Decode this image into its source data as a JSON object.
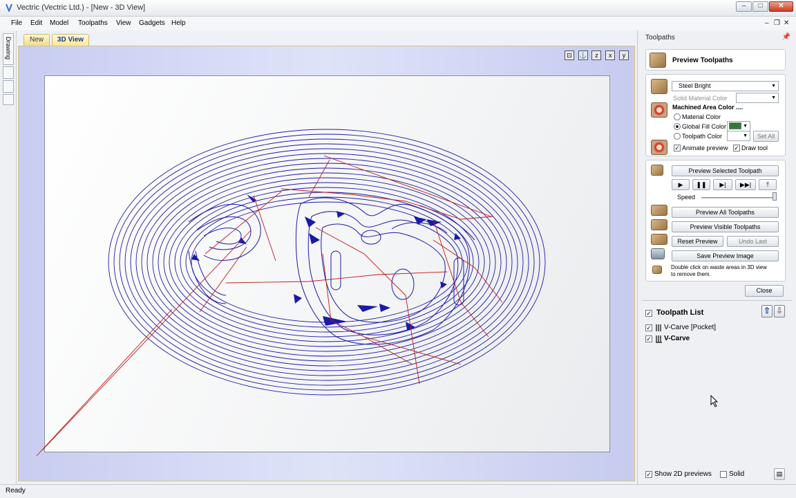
{
  "window": {
    "title": "Vectric (Vectric Ltd.) - [New - 3D View]",
    "controls": {
      "minimize": "–",
      "maximize": "□",
      "close": "✕"
    }
  },
  "menu": {
    "items": [
      "File",
      "Edit",
      "Model",
      "Toolpaths",
      "View",
      "Gadgets",
      "Help"
    ],
    "doc_controls": {
      "minimize": "–",
      "restore": "❐",
      "close": "✕"
    }
  },
  "left_strip": {
    "tab_label": "Drawing"
  },
  "tabs": [
    {
      "label": "New",
      "active": false
    },
    {
      "label": "3D View",
      "active": true
    }
  ],
  "view_toolbar": {
    "icons": [
      "zoom-extents-icon",
      "view-iso-icon",
      "view-z-icon",
      "view-x-icon",
      "view-y-icon"
    ],
    "labels": [
      "⊡",
      "⚓",
      "z",
      "x",
      "y"
    ]
  },
  "toolpaths_panel": {
    "title": "Toolpaths",
    "preview_header": "Preview Toolpaths",
    "material": {
      "selected": "Steel Bright",
      "solid_material_color_label": "Solid Material Color",
      "machined_area_color_label": "Machined Area Color ....",
      "options": [
        {
          "label": "Material Color",
          "selected": false
        },
        {
          "label": "Global Fill Color",
          "selected": true
        },
        {
          "label": "Toolpath Color",
          "selected": false
        }
      ],
      "global_fill_color": "#2e7d32",
      "set_all_label": "Set All",
      "animate_preview": {
        "label": "Animate preview",
        "checked": true
      },
      "draw_tool": {
        "label": "Draw tool",
        "checked": true
      }
    },
    "preview": {
      "preview_selected": "Preview Selected Toolpath",
      "playback": {
        "play": "▶",
        "pause": "❚❚",
        "step": "▶|",
        "fast_forward": "▶▶|",
        "to_top": "⤒"
      },
      "speed_label": "Speed",
      "speed_value": 1.0,
      "preview_all": "Preview All Toolpaths",
      "preview_visible": "Preview Visible Toolpaths",
      "reset_preview": "Reset Preview",
      "undo_last": "Undo Last",
      "save_image": "Save Preview Image",
      "hint": "Double click on waste areas in 3D view to remove them.",
      "hint_line1": "Double click on waste areas in 3D view",
      "hint_line2": "to remove them."
    },
    "close_label": "Close",
    "toolpath_list": {
      "title": "Toolpath List",
      "checked": true,
      "items": [
        {
          "label": "V-Carve [Pocket]",
          "checked": true,
          "bold": false
        },
        {
          "label": "V-Carve",
          "checked": true,
          "bold": true
        }
      ]
    },
    "footer": {
      "show_2d_previews": {
        "label": "Show 2D previews",
        "checked": true
      },
      "solid": {
        "label": "Solid",
        "checked": false
      }
    }
  },
  "status": {
    "text": "Ready"
  },
  "colors": {
    "toolpath_blue": "#1a1aa8",
    "rapid_red": "#c01818",
    "viewport_bg": "#d2d6f4",
    "tab_active": "#ffe78e"
  }
}
